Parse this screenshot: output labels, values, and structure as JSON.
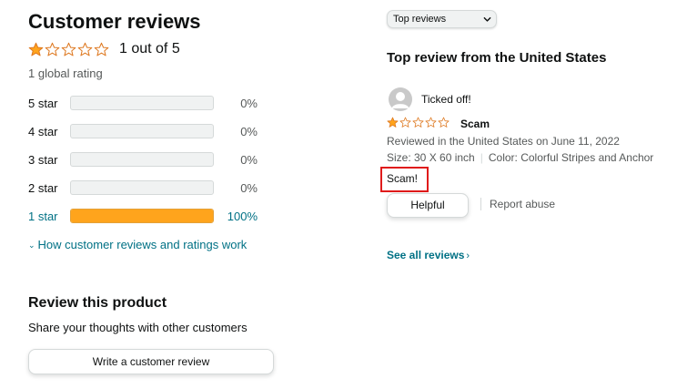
{
  "summary": {
    "title": "Customer reviews",
    "rating_value": 1,
    "rating_max": 5,
    "rating_text": "1 out of 5",
    "global_rating": "1 global rating"
  },
  "histogram": [
    {
      "label": "5 star",
      "percent_text": "0%",
      "percent": 0
    },
    {
      "label": "4 star",
      "percent_text": "0%",
      "percent": 0
    },
    {
      "label": "3 star",
      "percent_text": "0%",
      "percent": 0
    },
    {
      "label": "2 star",
      "percent_text": "0%",
      "percent": 0
    },
    {
      "label": "1 star",
      "percent_text": "100%",
      "percent": 100
    }
  ],
  "how_link": "How customer reviews and ratings work",
  "review_product": {
    "title": "Review this product",
    "subtitle": "Share your thoughts with other customers",
    "button": "Write a customer review"
  },
  "sort": {
    "selected": "Top reviews",
    "caret_icon": "chevron-down-icon"
  },
  "top_review": {
    "section_title": "Top review from the United States",
    "reviewer": "Ticked off!",
    "stars": 1,
    "headline": "Scam",
    "date_line": "Reviewed in the United States on June 11, 2022",
    "size": "Size: 30 X 60 inch",
    "color": "Color: Colorful Stripes and Anchor",
    "body": "Scam!",
    "helpful_button": "Helpful",
    "report_link": "Report abuse"
  },
  "see_all": "See all reviews",
  "colors": {
    "star": "#ffa41c",
    "link": "#007185",
    "highlight_border": "#e01b1b"
  }
}
